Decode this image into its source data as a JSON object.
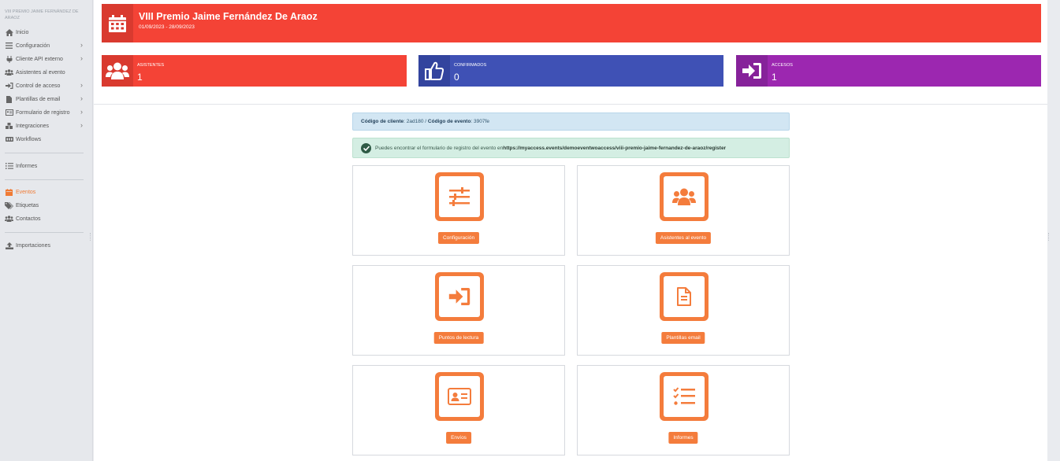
{
  "sidebar": {
    "title": "VIII PREMIO JAIME FERNÁNDEZ DE ARAOZ",
    "items": [
      {
        "label": "Inicio",
        "icon": "home-icon",
        "chevron": false
      },
      {
        "label": "Configuración",
        "icon": "menu-icon",
        "chevron": true
      },
      {
        "label": "Cliente API externo",
        "icon": "plug-icon",
        "chevron": true
      },
      {
        "label": "Asistentes al evento",
        "icon": "users-icon",
        "chevron": false
      },
      {
        "label": "Control de acceso",
        "icon": "sign-in-icon",
        "chevron": true
      },
      {
        "label": "Plantillas de email",
        "icon": "file-icon",
        "chevron": true
      },
      {
        "label": "Formulario de registro",
        "icon": "id-card-icon",
        "chevron": true
      },
      {
        "label": "Integraciones",
        "icon": "cubes-icon",
        "chevron": true
      },
      {
        "label": "Workflows",
        "icon": "workflow-icon",
        "chevron": false
      }
    ],
    "reports": {
      "label": "Informes",
      "icon": "list-icon"
    },
    "section2": [
      {
        "label": "Eventos",
        "icon": "calendar-icon",
        "active": true
      },
      {
        "label": "Etiquetas",
        "icon": "tags-icon",
        "active": false
      },
      {
        "label": "Contactos",
        "icon": "users-icon",
        "active": false
      }
    ],
    "imports": {
      "label": "Importaciones",
      "icon": "upload-icon"
    }
  },
  "header": {
    "title": "VIII Premio Jaime Fernández De Araoz",
    "dates": "01/09/2023 - 28/09/2023",
    "color": "#f44336"
  },
  "stats": [
    {
      "label": "ASISTENTES",
      "value": "1",
      "color": "#f44336",
      "dark": "#d93a2f",
      "icon": "users-icon"
    },
    {
      "label": "CONFIRMADOS",
      "value": "0",
      "color": "#3f51b5",
      "dark": "#33449e",
      "icon": "thumbs-up-icon"
    },
    {
      "label": "ACCESOS",
      "value": "1",
      "color": "#9c27b0",
      "dark": "#86229a",
      "icon": "sign-in-icon"
    }
  ],
  "info": {
    "client_label": "Código de cliente",
    "client_value": ": 2ad180 / ",
    "event_label": "Código de evento",
    "event_value": ": 3907fe"
  },
  "success": {
    "text": "Puedes encontrar el formulario de registro del evento en ",
    "url": "https://myaccess.events/demoeventwoaccess/viii-premio-jaime-fernandez-de-araoz/register"
  },
  "cards": [
    {
      "label": "Configuración",
      "icon": "sliders-icon"
    },
    {
      "label": "Asistentes al evento",
      "icon": "users-icon"
    },
    {
      "label": "Puntos de lectura",
      "icon": "sign-in-icon"
    },
    {
      "label": "Plantillas email",
      "icon": "file-icon"
    },
    {
      "label": "Envíos",
      "icon": "id-card-icon"
    },
    {
      "label": "Informes",
      "icon": "checklist-icon"
    }
  ],
  "accent": "#f47c3c"
}
